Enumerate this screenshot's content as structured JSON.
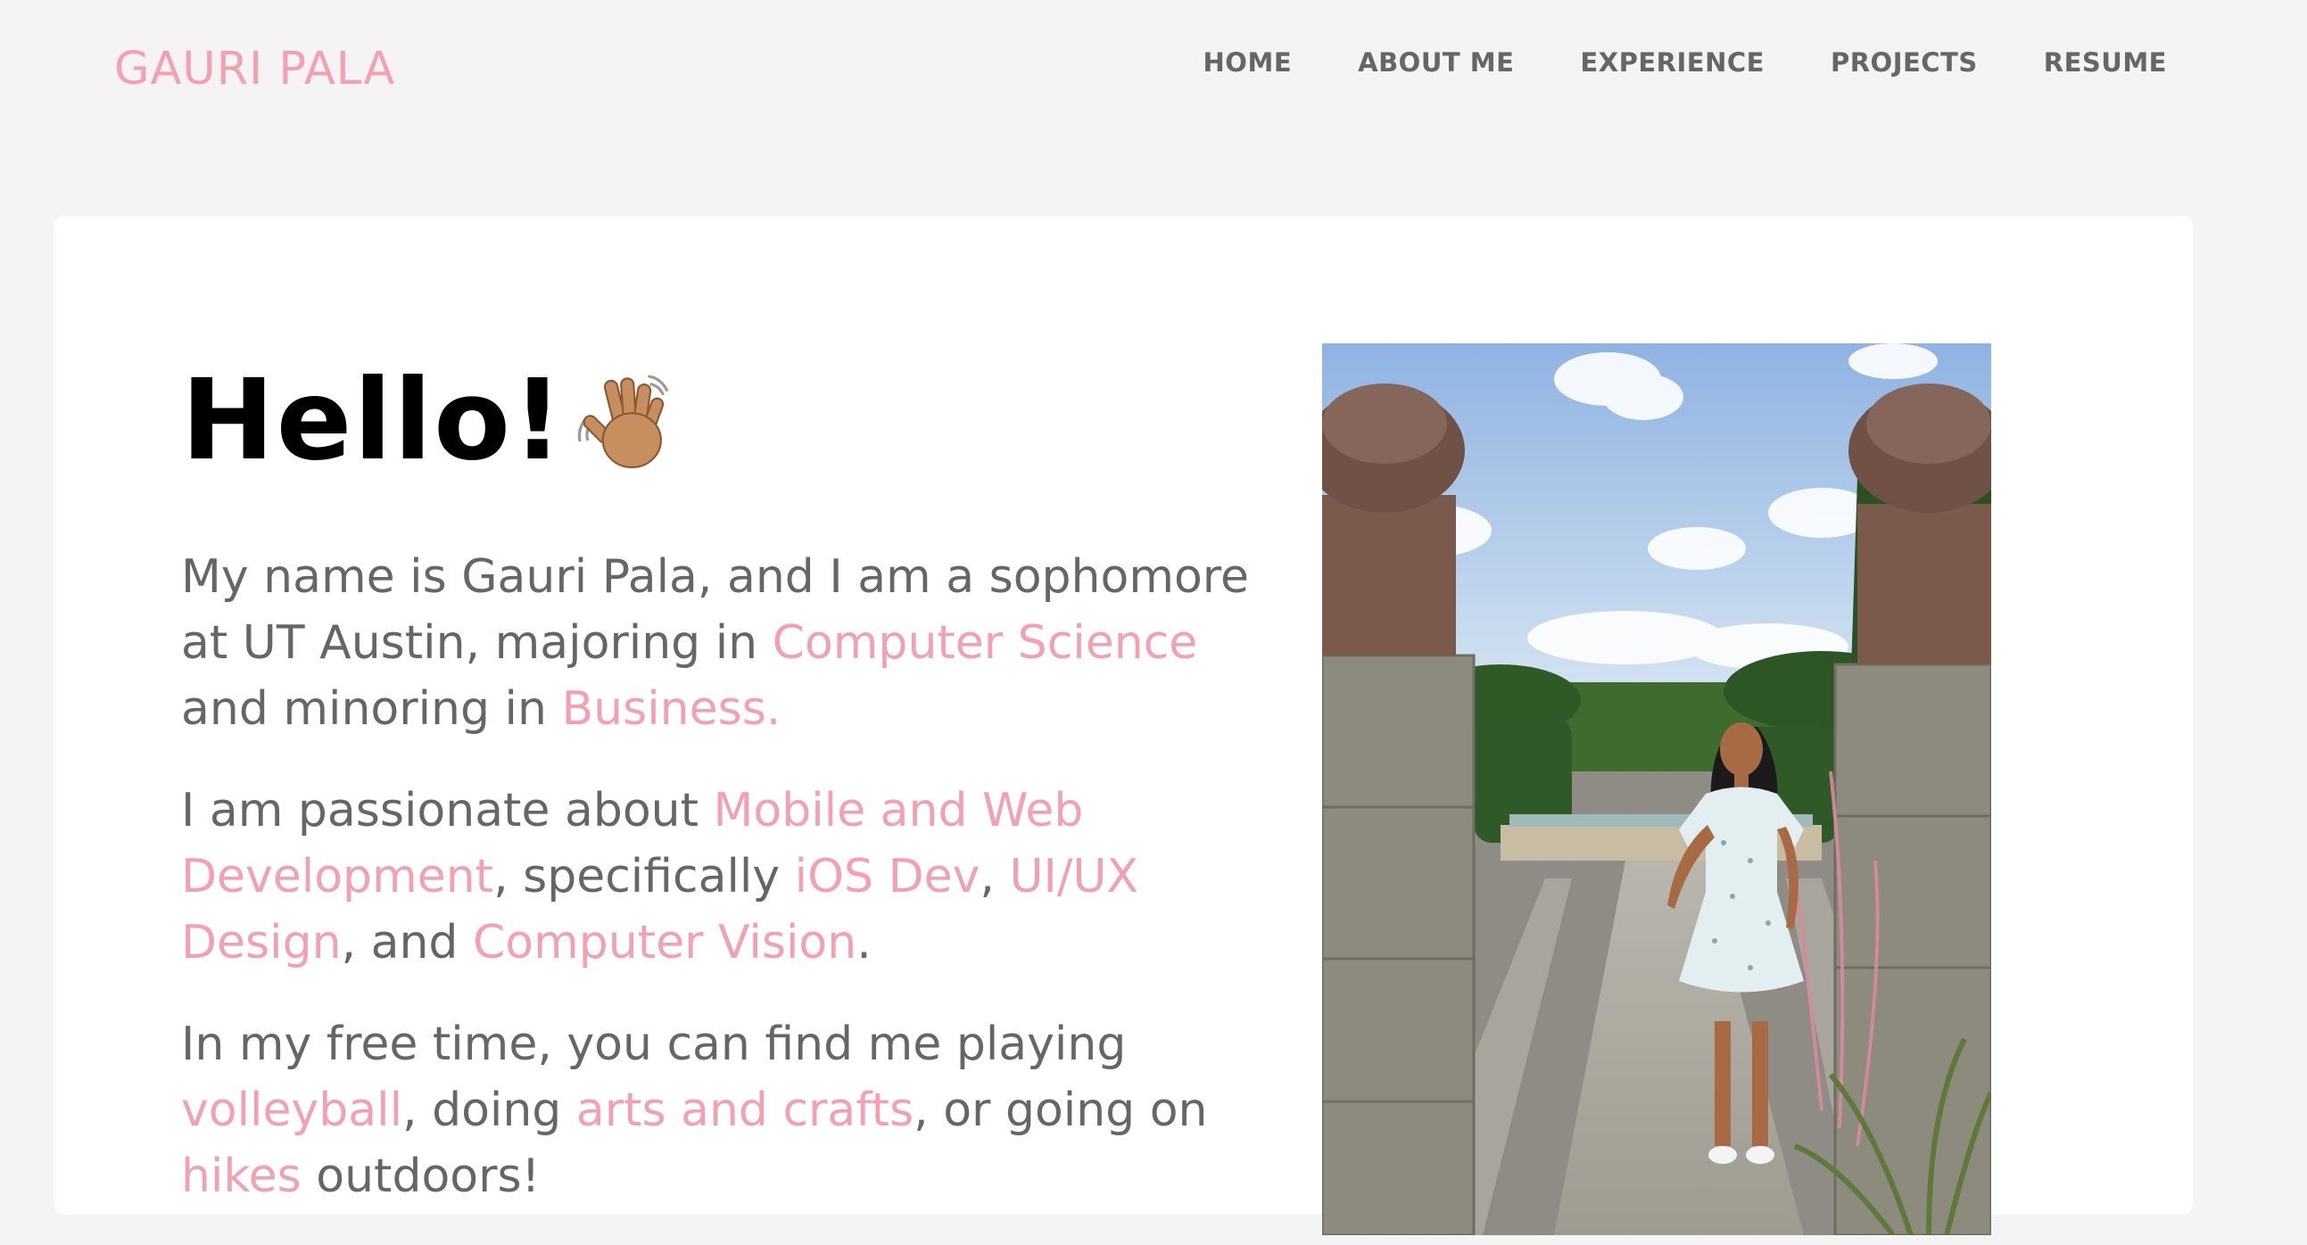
{
  "header": {
    "brand": "GAURI PALA",
    "nav": [
      "HOME",
      "ABOUT ME",
      "EXPERIENCE",
      "PROJECTS",
      "RESUME"
    ]
  },
  "main": {
    "greeting": "Hello!",
    "p1": {
      "a": "My name is Gauri Pala, and I am a sophomore at UT Austin, majoring in ",
      "b": "Computer Science",
      "c": " and minoring in ",
      "d": "Business."
    },
    "p2": {
      "a": "I am passionate about ",
      "b": "Mobile and Web Development",
      "c": ", specifically ",
      "d": "iOS Dev",
      "e": ", ",
      "f": "UI/UX Design",
      "g": ", and ",
      "h": "Computer Vision",
      "i": "."
    },
    "p3": {
      "a": "In my free time, you can find me playing ",
      "b": "volleyball",
      "c": ", doing ",
      "d": "arts and crafts",
      "e": ", or going on ",
      "f": "hikes",
      "g": " outdoors!"
    }
  },
  "colors": {
    "accent": "#f2a1b2",
    "text": "#666666",
    "background": "#f5f3f4"
  },
  "icons": {
    "greeting_icon": "waving-hand-icon"
  }
}
